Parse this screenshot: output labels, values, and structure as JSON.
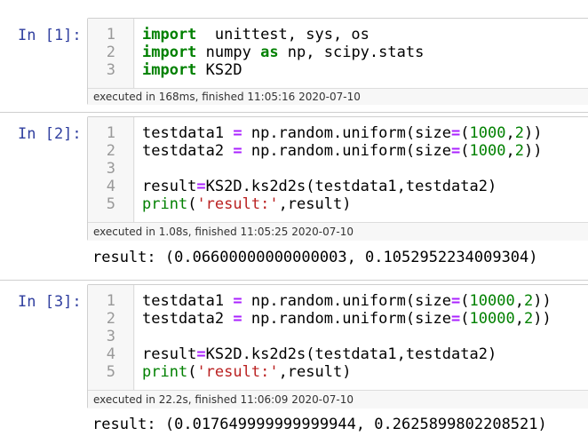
{
  "cells": [
    {
      "prompt": "In [1]:",
      "lines": [
        [
          "1",
          [
            [
              "kw",
              "import"
            ],
            [
              "",
              "  unittest, sys, os"
            ]
          ]
        ],
        [
          "2",
          [
            [
              "kw",
              "import"
            ],
            [
              "",
              " numpy "
            ],
            [
              "kw",
              "as"
            ],
            [
              "",
              " np, scipy.stats"
            ]
          ]
        ],
        [
          "3",
          [
            [
              "kw",
              "import"
            ],
            [
              "",
              " KS2D"
            ]
          ]
        ]
      ],
      "footer": "executed in 168ms, finished 11:05:16 2020-07-10",
      "output": ""
    },
    {
      "prompt": "In [2]:",
      "lines": [
        [
          "1",
          [
            [
              "",
              "testdata1 "
            ],
            [
              "op",
              "="
            ],
            [
              "",
              " np.random.uniform(size"
            ],
            [
              "op",
              "="
            ],
            [
              "",
              "("
            ],
            [
              "num",
              "1000"
            ],
            [
              "",
              ","
            ],
            [
              "num",
              "2"
            ],
            [
              "",
              "))"
            ]
          ]
        ],
        [
          "2",
          [
            [
              "",
              "testdata2 "
            ],
            [
              "op",
              "="
            ],
            [
              "",
              " np.random.uniform(size"
            ],
            [
              "op",
              "="
            ],
            [
              "",
              "("
            ],
            [
              "num",
              "1000"
            ],
            [
              "",
              ","
            ],
            [
              "num",
              "2"
            ],
            [
              "",
              "))"
            ]
          ]
        ],
        [
          "3",
          []
        ],
        [
          "4",
          [
            [
              "",
              "result"
            ],
            [
              "op",
              "="
            ],
            [
              "",
              "KS2D.ks2d2s(testdata1,testdata2)"
            ]
          ]
        ],
        [
          "5",
          [
            [
              "bi",
              "print"
            ],
            [
              "",
              "("
            ],
            [
              "str",
              "'result:'"
            ],
            [
              "",
              ",result)"
            ]
          ]
        ]
      ],
      "footer": "executed in 1.08s, finished 11:05:25 2020-07-10",
      "output": "result: (0.06600000000000003, 0.1052952234009304)"
    },
    {
      "prompt": "In [3]:",
      "lines": [
        [
          "1",
          [
            [
              "",
              "testdata1 "
            ],
            [
              "op",
              "="
            ],
            [
              "",
              " np.random.uniform(size"
            ],
            [
              "op",
              "="
            ],
            [
              "",
              "("
            ],
            [
              "num",
              "10000"
            ],
            [
              "",
              ","
            ],
            [
              "num",
              "2"
            ],
            [
              "",
              "))"
            ]
          ]
        ],
        [
          "2",
          [
            [
              "",
              "testdata2 "
            ],
            [
              "op",
              "="
            ],
            [
              "",
              " np.random.uniform(size"
            ],
            [
              "op",
              "="
            ],
            [
              "",
              "("
            ],
            [
              "num",
              "10000"
            ],
            [
              "",
              ","
            ],
            [
              "num",
              "2"
            ],
            [
              "",
              "))"
            ]
          ]
        ],
        [
          "3",
          []
        ],
        [
          "4",
          [
            [
              "",
              "result"
            ],
            [
              "op",
              "="
            ],
            [
              "",
              "KS2D.ks2d2s(testdata1,testdata2)"
            ]
          ]
        ],
        [
          "5",
          [
            [
              "bi",
              "print"
            ],
            [
              "",
              "("
            ],
            [
              "str",
              "'result:'"
            ],
            [
              "",
              ",result)"
            ]
          ]
        ]
      ],
      "footer": "executed in 22.2s, finished 11:06:09 2020-07-10",
      "output": "result: (0.017649999999999944, 0.2625899802208521)"
    }
  ]
}
